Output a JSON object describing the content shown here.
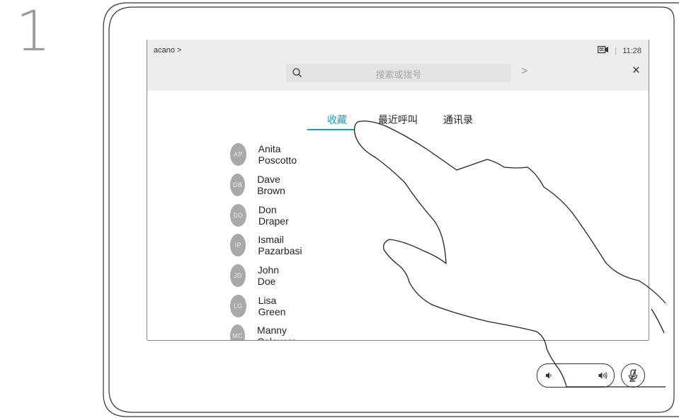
{
  "step": {
    "number": "1"
  },
  "header": {
    "breadcrumb": "acano >",
    "time": "11:28",
    "separator": "|"
  },
  "search": {
    "placeholder": "搜索或拨号",
    "go_label": ">",
    "close_label": "×"
  },
  "tabs": [
    {
      "label": "收藏",
      "active": true
    },
    {
      "label": "最近呼叫",
      "active": false
    },
    {
      "label": "通讯录",
      "active": false
    }
  ],
  "contacts": [
    {
      "initials": "AP",
      "name": "Anita Poscotto"
    },
    {
      "initials": "DB",
      "name": "Dave Brown"
    },
    {
      "initials": "DD",
      "name": "Don Draper"
    },
    {
      "initials": "IP",
      "name": "Ismail Pazarbasi"
    },
    {
      "initials": "JD",
      "name": "John Doe"
    },
    {
      "initials": "LG",
      "name": "Lisa Green"
    },
    {
      "initials": "MC",
      "name": "Manny Calavera"
    }
  ],
  "controls": {
    "volume_down_icon": "speaker-low-icon",
    "volume_up_icon": "speaker-high-icon",
    "mute_icon": "mic-muted-icon"
  },
  "colors": {
    "accent": "#08a5c9",
    "avatar": "#a9a9a9",
    "topbar": "#ededed"
  }
}
